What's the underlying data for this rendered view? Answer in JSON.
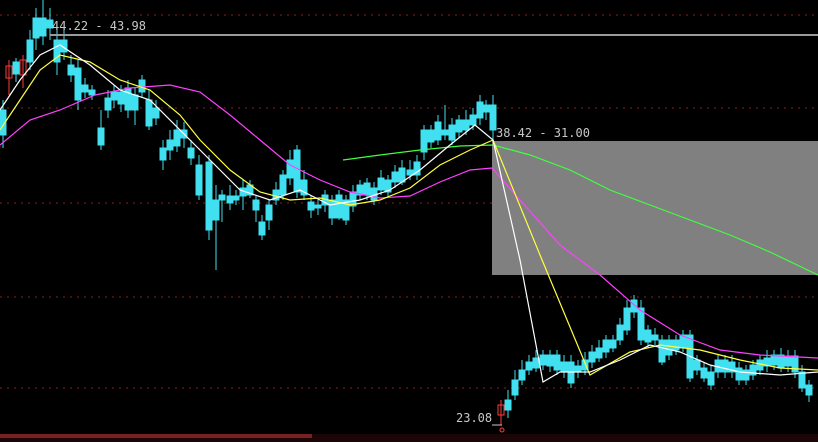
{
  "chart_data": {
    "type": "candlestick",
    "grid": true,
    "colors": {
      "background": "#000000",
      "up": "#ff3b3b",
      "down": "#40e0f0",
      "ma_short": "#ffffff",
      "ma_mid": "#ffff40",
      "ma_long": "#ff40ff",
      "ma_extra": "#40ff40",
      "grid": "#8a2020",
      "box": "#808080",
      "annotation": "#c8c8c8"
    },
    "annotations": {
      "range_top": "44.22 - 43.98",
      "range_mid": "38.42 - 31.00",
      "low_label": "23.08"
    }
  }
}
